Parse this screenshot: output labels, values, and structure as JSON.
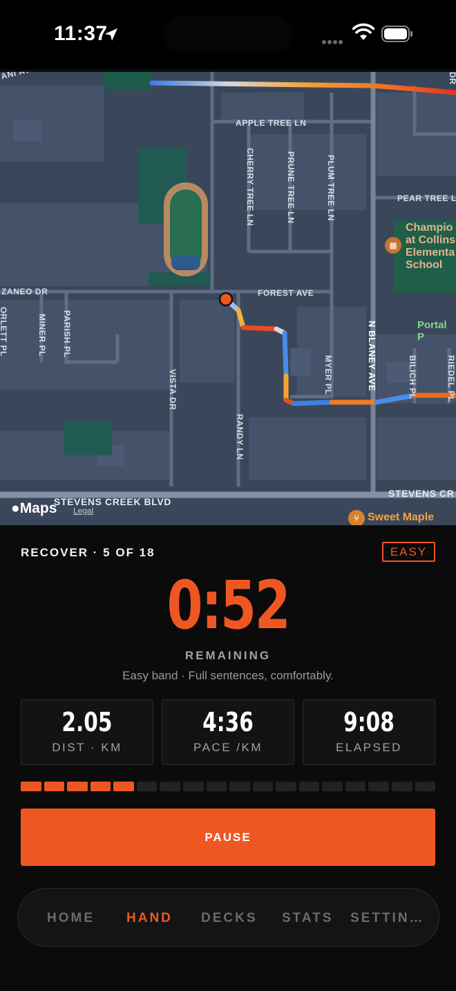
{
  "status_bar": {
    "time": "11:37"
  },
  "map": {
    "streets": {
      "apple_tree": "APPLE TREE LN",
      "pear_tree": "PEAR TREE L",
      "cherry_tree": "CHERRY TREE LN",
      "prune_tree": "PRUNE TREE LN",
      "plum_tree": "PLUM TREE LN",
      "forest": "FOREST AVE",
      "zaneo": "ZANEO DR",
      "miner": "MINER PL",
      "parish": "PARISH PL",
      "vista": "VISTA DR",
      "randy": "RANDY LN",
      "myer": "MYER PL",
      "blaney": "N BLANEY AVE",
      "bilich": "BILICH PL",
      "riedel": "RIEDEL PL",
      "stevens_left": "STEVENS CREEK BLVD",
      "stevens_right": "STEVENS CR",
      "top_left": "ANI AVE",
      "top_right": "DR",
      "left_edge": "ORLETT PL"
    },
    "poi_school": [
      "Champio",
      "at Collins",
      "Elementa",
      "School"
    ],
    "poi_park": "Portal P",
    "poi_food": "Sweet Maple",
    "attribution": "Maps",
    "legal": "Legal"
  },
  "workout": {
    "phase": "RECOVER · 5 OF 18",
    "intensity": "EASY",
    "remaining_time": "0:52",
    "remaining_label": "REMAINING",
    "hint": "Easy band · Full sentences, comfortably.",
    "stats": [
      {
        "value": "2.05",
        "label": "DIST · KM"
      },
      {
        "value": "4:36",
        "label": "PACE /KM"
      },
      {
        "value": "9:08",
        "label": "ELAPSED"
      }
    ],
    "progress": {
      "completed": 5,
      "total": 18
    },
    "pause_label": "PAUSE"
  },
  "tabs": [
    {
      "label": "HOME",
      "active": false
    },
    {
      "label": "HAND",
      "active": true
    },
    {
      "label": "DECKS",
      "active": false
    },
    {
      "label": "STATS",
      "active": false
    },
    {
      "label": "SETTIN…",
      "active": false
    }
  ],
  "colors": {
    "accent": "#EF5722",
    "background": "#0B0B0B",
    "map": "#3A475A"
  }
}
